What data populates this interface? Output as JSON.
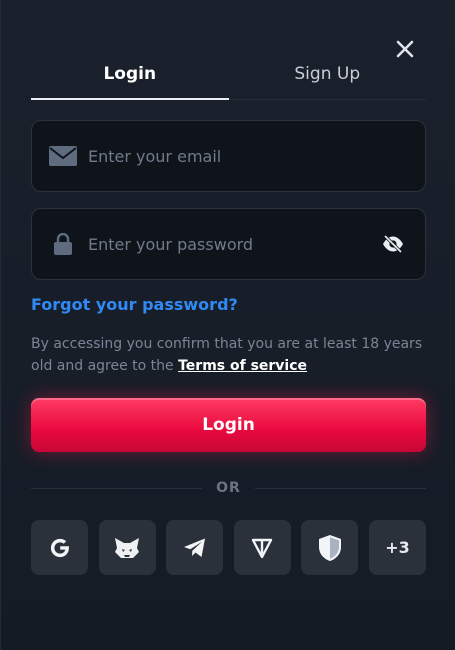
{
  "tabs": [
    {
      "label": "Login",
      "active": true
    },
    {
      "label": "Sign Up",
      "active": false
    }
  ],
  "email": {
    "placeholder": "Enter your email",
    "value": "",
    "icon": "mail-icon"
  },
  "password": {
    "placeholder": "Enter your password",
    "value": "",
    "icon": "lock-icon",
    "toggle_icon": "eye-off-icon"
  },
  "forgot_label": "Forgot your password?",
  "terms": {
    "text": "By accessing you confirm that you are at least 18 years old and agree to the",
    "link": "Terms of service"
  },
  "login_button": "Login",
  "or_label": "OR",
  "socials": [
    {
      "name": "google-icon"
    },
    {
      "name": "metamask-icon"
    },
    {
      "name": "telegram-icon"
    },
    {
      "name": "ton-icon"
    },
    {
      "name": "shield-icon"
    },
    {
      "label": "+3"
    }
  ],
  "colors": {
    "accent": "#e8093e",
    "link": "#2f8af5",
    "background": "#151b25"
  }
}
